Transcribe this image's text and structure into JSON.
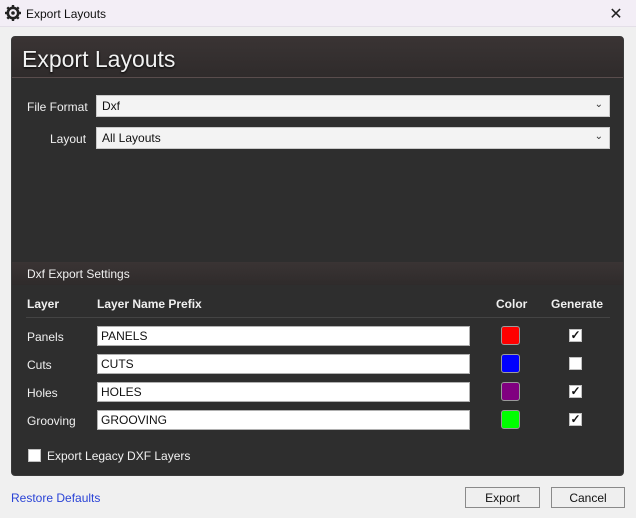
{
  "window": {
    "title": "Export Layouts",
    "close_glyph": "✕",
    "icon": "gear-icon"
  },
  "panel": {
    "title": "Export Layouts"
  },
  "form": {
    "file_format_label": "File Format",
    "file_format_value": "Dxf",
    "layout_label": "Layout",
    "layout_value": "All Layouts"
  },
  "dxf_settings": {
    "section_title": "Dxf Export Settings",
    "columns": {
      "layer": "Layer",
      "prefix": "Layer Name Prefix",
      "color": "Color",
      "generate": "Generate"
    },
    "rows": [
      {
        "layer": "Panels",
        "prefix": "PANELS",
        "color": "#ff0000",
        "generate": true
      },
      {
        "layer": "Cuts",
        "prefix": "CUTS",
        "color": "#0000ff",
        "generate": false
      },
      {
        "layer": "Holes",
        "prefix": "HOLES",
        "color": "#800080",
        "generate": true
      },
      {
        "layer": "Grooving",
        "prefix": "GROOVING",
        "color": "#00ff00",
        "generate": true
      }
    ],
    "legacy_label": "Export Legacy DXF Layers",
    "legacy_checked": false
  },
  "footer": {
    "restore_label": "Restore Defaults",
    "export_label": "Export",
    "cancel_label": "Cancel"
  }
}
